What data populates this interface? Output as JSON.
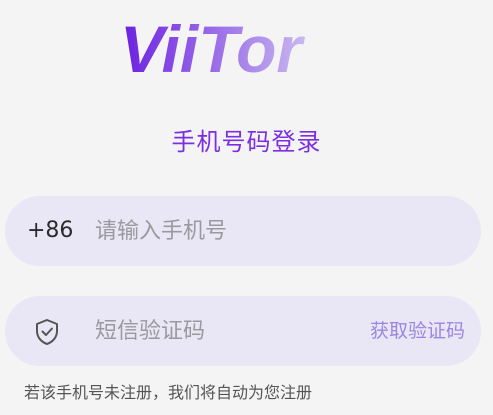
{
  "logo": {
    "text": "ViiTor",
    "gradient_start": "#6a1fe0",
    "gradient_end": "#c9b8ef"
  },
  "login": {
    "title": "手机号码登录",
    "phone": {
      "prefix": "+86",
      "placeholder": "请输入手机号"
    },
    "code": {
      "icon": "shield-check-icon",
      "placeholder": "短信验证码",
      "get_code_label": "获取验证码"
    },
    "hint": "若该手机号未注册，我们将自动为您注册"
  },
  "colors": {
    "accent": "#7b2fe0",
    "field_bg": "#e9e6f6",
    "page_bg": "#f4f4f5",
    "link": "#9b86e0"
  }
}
